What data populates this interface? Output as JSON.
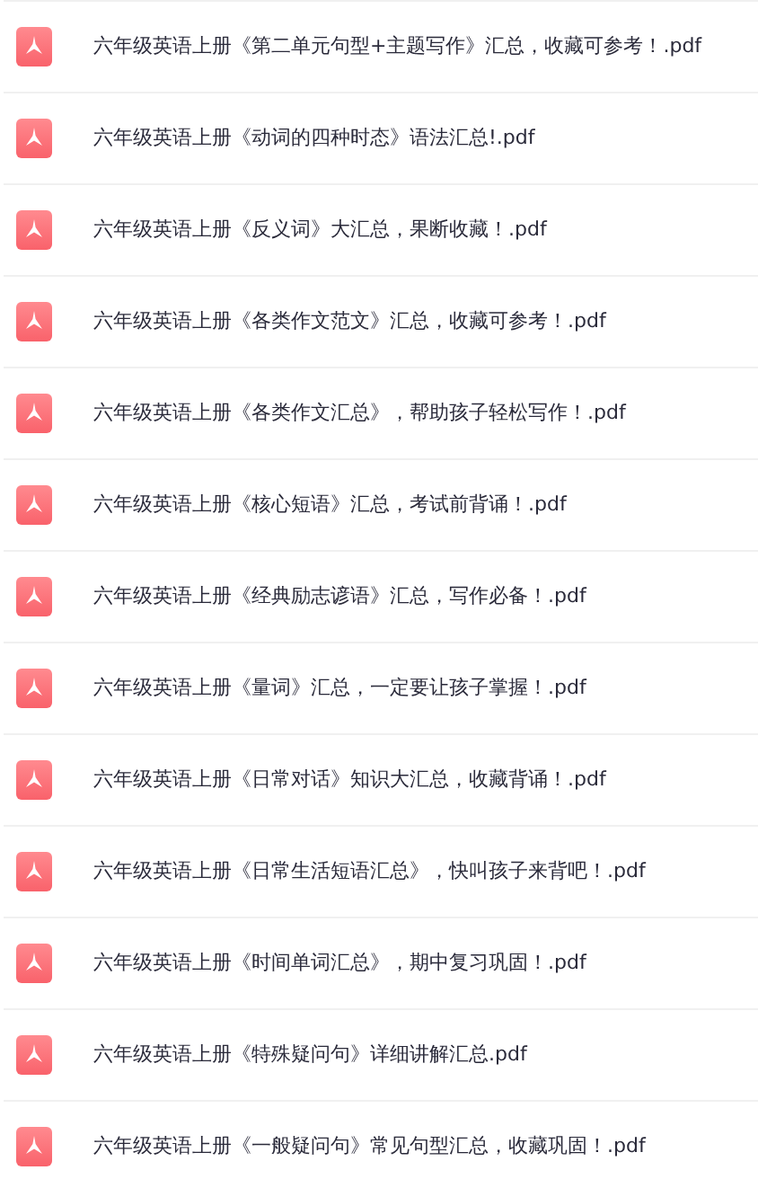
{
  "files": [
    {
      "name": "六年级英语上册《第二单元句型+主题写作》汇总，收藏可参考！.pdf"
    },
    {
      "name": "六年级英语上册《动词的四种时态》语法汇总!.pdf"
    },
    {
      "name": "六年级英语上册《反义词》大汇总，果断收藏！.pdf"
    },
    {
      "name": "六年级英语上册《各类作文范文》汇总，收藏可参考！.pdf"
    },
    {
      "name": "六年级英语上册《各类作文汇总》，帮助孩子轻松写作！.pdf"
    },
    {
      "name": "六年级英语上册《核心短语》汇总，考试前背诵！.pdf"
    },
    {
      "name": "六年级英语上册《经典励志谚语》汇总，写作必备！.pdf"
    },
    {
      "name": "六年级英语上册《量词》汇总，一定要让孩子掌握！.pdf"
    },
    {
      "name": "六年级英语上册《日常对话》知识大汇总，收藏背诵！.pdf"
    },
    {
      "name": "六年级英语上册《日常生活短语汇总》，快叫孩子来背吧！.pdf"
    },
    {
      "name": "六年级英语上册《时间单词汇总》，期中复习巩固！.pdf"
    },
    {
      "name": "六年级英语上册《特殊疑问句》详细讲解汇总.pdf"
    },
    {
      "name": "六年级英语上册《一般疑问句》常见句型汇总，收藏巩固！.pdf"
    }
  ]
}
